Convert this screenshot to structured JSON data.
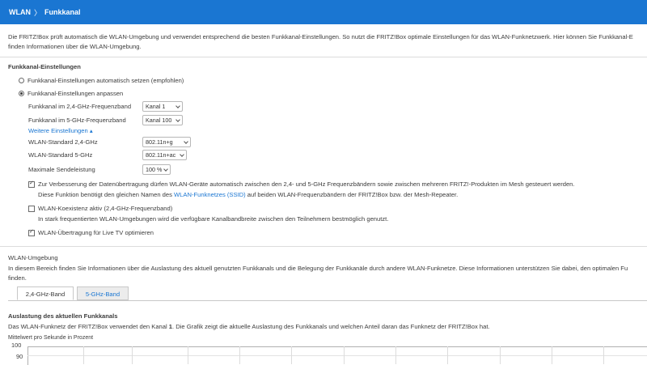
{
  "header": {
    "crumb": "WLAN",
    "separator": "〉",
    "title": "Funkkanal"
  },
  "intro": {
    "line1": "Die FRITZ!Box prüft automatisch die WLAN-Umgebung und verwendet entsprechend die besten Funkkanal-Einstellungen. So nutzt die FRITZ!Box optimale Einstellungen für das WLAN-Funknetzwerk. Hier können Sie Funkkanal-E",
    "line2": "finden Informationen über die WLAN-Umgebung."
  },
  "settings": {
    "title": "Funkkanal-Einstellungen",
    "radio_auto": "Funkkanal-Einstellungen automatisch setzen (empfohlen)",
    "radio_custom": "Funkkanal-Einstellungen anpassen",
    "channel24_label": "Funkkanal im 2,4-GHz-Frequenzband",
    "channel24_value": "Kanal 1",
    "channel5_label": "Funkkanal im 5-GHz-Frequenzband",
    "channel5_value": "Kanal 100",
    "more_link": "Weitere Einstellungen ▴",
    "std24_label": "WLAN-Standard 2,4-GHz",
    "std24_value": "802.11n+g",
    "std5_label": "WLAN-Standard 5-GHz",
    "std5_value": "802.11n+ac",
    "power_label": "Maximale Sendeleistung",
    "power_value": "100 %",
    "cb_band_line1": "Zur Verbesserung der Datenübertragung dürfen WLAN-Geräte automatisch zwischen den 2,4- und 5-GHz Frequenzbändern sowie zwischen mehreren FRITZ!-Produkten im Mesh gesteuert werden.",
    "cb_band_line2a": "Diese Funktion benötigt den gleichen Namen des ",
    "cb_band_link": "WLAN-Funknetzes (SSID)",
    "cb_band_line2b": " auf beiden WLAN-Frequenzbändern der FRITZ!Box bzw. der Mesh-Repeater.",
    "cb_coex_line1": "WLAN-Koexistenz aktiv (2,4-GHz-Frequenzband)",
    "cb_coex_line2": "In stark frequentierten WLAN-Umgebungen wird die verfügbare Kanalbandbreite zwischen den Teilnehmern bestmöglich genutzt.",
    "cb_tv": "WLAN-Übertragung für Live TV optimieren"
  },
  "environment": {
    "title": "WLAN-Umgebung",
    "line1": "In diesem Bereich finden Sie Informationen über die Auslastung des aktuell genutzten Funkkanals und die Belegung der Funkkanäle durch andere WLAN-Funknetze. Diese Informationen unterstützen Sie dabei, den optimalen Fu",
    "line2": "finden.",
    "tabs": [
      "2,4-GHz-Band",
      "5-GHz-Band"
    ]
  },
  "load": {
    "title": "Auslastung des aktuellen Funkkanals",
    "desc_a": "Das WLAN-Funknetz der FRITZ!Box verwendet den Kanal ",
    "desc_channel": "1",
    "desc_b": ". Die Grafik zeigt die aktuelle Auslastung des Funkkanals und welchen Anteil daran das Funknetz der FRITZ!Box hat.",
    "axis_caption": "Mittelwert pro Sekunde in Prozent"
  },
  "chart_data": {
    "type": "line",
    "ylabel": "Mittelwert pro Sekunde in Prozent",
    "yticks": [
      "100",
      "90"
    ],
    "ylim": [
      0,
      100
    ],
    "grid": true,
    "series": []
  },
  "colors": {
    "header": "#1a76d2",
    "link": "#1a76d2"
  }
}
